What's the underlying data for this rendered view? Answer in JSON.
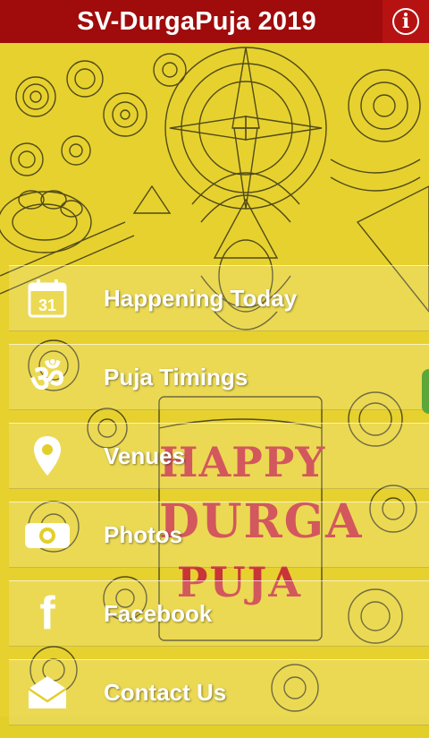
{
  "header": {
    "title": "SV-DurgaPuja 2019",
    "info_icon": "info-icon"
  },
  "artwork": {
    "line1": "HAPPY",
    "line2": "DURGA",
    "line3": "PUJA"
  },
  "menu": {
    "items": [
      {
        "label": "Happening Today",
        "icon": "calendar-icon",
        "icon_text": "31"
      },
      {
        "label": "Puja Timings",
        "icon": "om-icon",
        "icon_text": "ॐ"
      },
      {
        "label": "Venues",
        "icon": "location-pin-icon"
      },
      {
        "label": "Photos",
        "icon": "camera-icon"
      },
      {
        "label": "Facebook",
        "icon": "facebook-icon",
        "icon_text": "f"
      },
      {
        "label": "Contact Us",
        "icon": "mail-icon"
      }
    ]
  },
  "colors": {
    "header_bg": "#a00b0b",
    "background": "#e3cf2a",
    "art_text": "#c9343a"
  }
}
